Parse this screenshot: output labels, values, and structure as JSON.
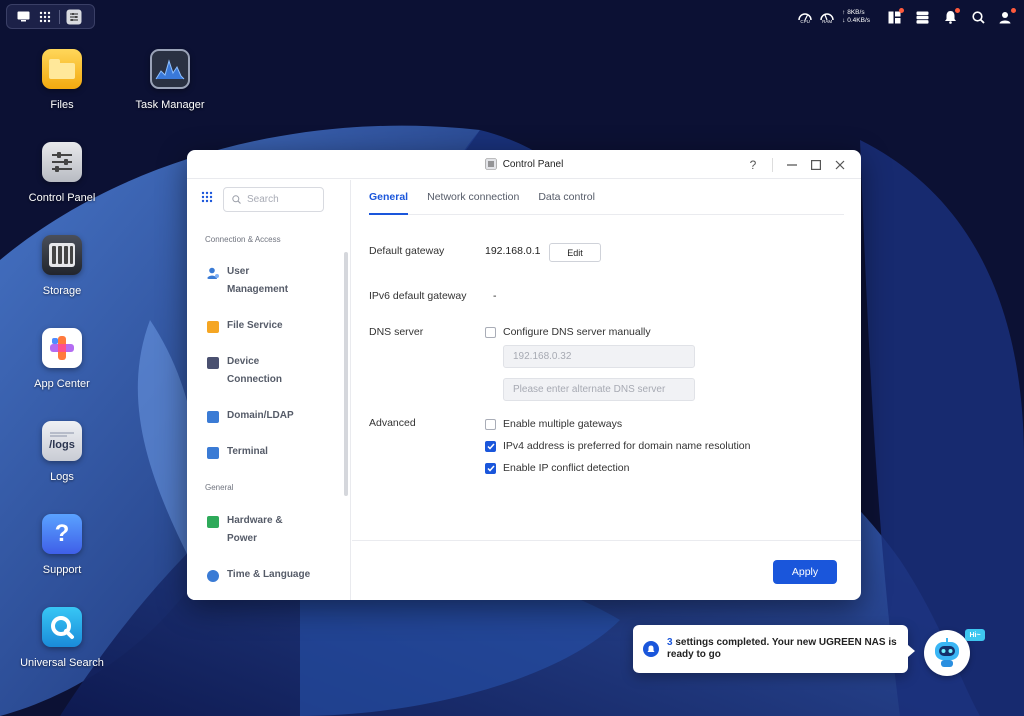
{
  "taskbar": {
    "network": {
      "up": "8KB/s",
      "down": "0.4KB/s"
    },
    "gauges": [
      "CPU",
      "RAM"
    ]
  },
  "desktop": {
    "icons": [
      {
        "label": "Files"
      },
      {
        "label": "Task Manager"
      },
      {
        "label": "Control Panel"
      },
      {
        "label": "Storage"
      },
      {
        "label": "App Center"
      },
      {
        "label": "Logs",
        "tile_text": "/logs"
      },
      {
        "label": "Support"
      },
      {
        "label": "Universal Search"
      }
    ]
  },
  "window": {
    "title": "Control Panel",
    "help": "?",
    "sidebar": {
      "search_placeholder": "Search",
      "groups": [
        {
          "label": "Connection & Access",
          "items": [
            {
              "label": "User Management",
              "color": "#3a7bd5"
            },
            {
              "label": "File Service",
              "color": "#f5a623"
            },
            {
              "label": "Device Connection",
              "color": "#4a5070"
            },
            {
              "label": "Domain/LDAP",
              "color": "#3a7bd5"
            },
            {
              "label": "Terminal",
              "color": "#3a7bd5"
            }
          ]
        },
        {
          "label": "General",
          "items": [
            {
              "label": "Hardware & Power",
              "color": "#2eaa5a"
            },
            {
              "label": "Time & Language",
              "color": "#3a7bd5"
            }
          ]
        }
      ]
    },
    "tabs": [
      {
        "label": "General",
        "active": true
      },
      {
        "label": "Network connection",
        "active": false
      },
      {
        "label": "Data control",
        "active": false
      }
    ],
    "settings": {
      "default_gateway": {
        "label": "Default gateway",
        "value": "192.168.0.1",
        "button": "Edit"
      },
      "ipv6_gateway": {
        "label": "IPv6 default gateway",
        "value": "-"
      },
      "dns": {
        "label": "DNS server",
        "checkbox": {
          "label": "Configure DNS server manually",
          "checked": false
        },
        "primary_placeholder": "192.168.0.32",
        "alternate_placeholder": "Please enter alternate DNS server"
      },
      "advanced": {
        "label": "Advanced",
        "options": [
          {
            "label": "Enable multiple gateways",
            "checked": false
          },
          {
            "label": "IPv4 address is preferred for domain name resolution",
            "checked": true
          },
          {
            "label": "Enable IP conflict detection",
            "checked": true
          }
        ]
      }
    },
    "apply_label": "Apply"
  },
  "notification": {
    "count": "3",
    "message": "settings completed. Your new UGREEN NAS is ready to go",
    "mascot_bubble": "Hi~"
  },
  "colors": {
    "accent": "#1a56db",
    "desktop_bg": "#0d1236"
  }
}
